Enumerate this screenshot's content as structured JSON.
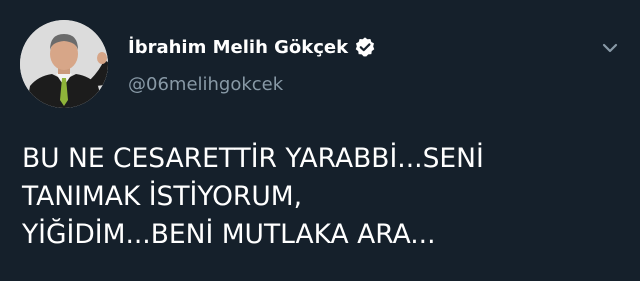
{
  "author": {
    "display_name": "İbrahim Melih Gökçek",
    "handle": "@06melihgokcek",
    "verified": true,
    "avatar_icon": "profile-photo"
  },
  "tweet": {
    "lines": [
      "BU NE CESARETTİR YARABBİ...SENİ",
      "TANIMAK İSTİYORUM,",
      "YİĞİDİM...BENİ MUTLAKA ARA..."
    ]
  },
  "icons": {
    "verified": "verified-badge-icon",
    "menu": "chevron-down-icon"
  },
  "colors": {
    "background": "#15202b",
    "text_primary": "#ffffff",
    "text_secondary": "#8899a6"
  }
}
